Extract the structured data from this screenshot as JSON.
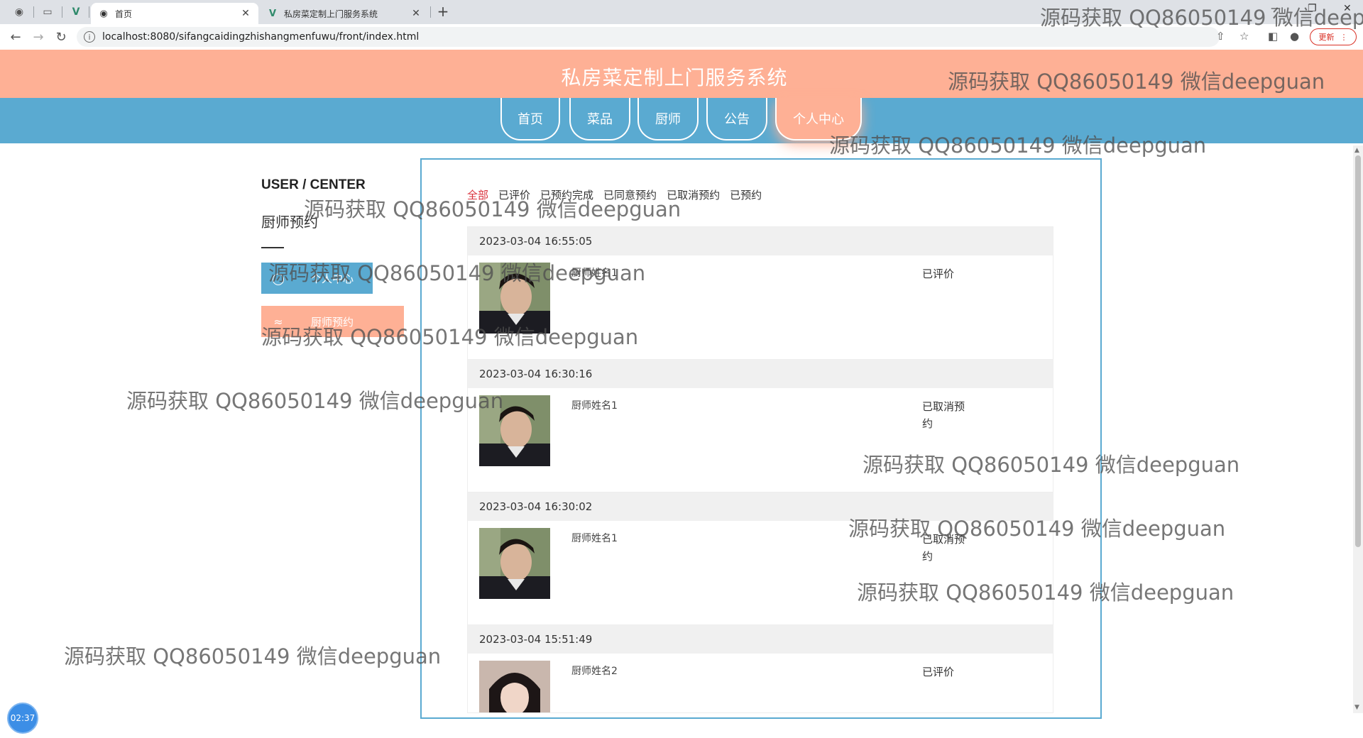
{
  "browser": {
    "tabs": [
      {
        "title": "首页",
        "active": true
      },
      {
        "title": "私房菜定制上门服务系统",
        "active": false
      }
    ],
    "url": "localhost:8080/sifangcaidingzhishangmenfuwu/front/index.html",
    "update_label": "更新"
  },
  "site": {
    "title": "私房菜定制上门服务系统",
    "nav": [
      "首页",
      "菜品",
      "厨师",
      "公告",
      "个人中心"
    ]
  },
  "sidebar": {
    "heading": "USER / CENTER",
    "subheading": "厨师预约",
    "items": [
      "个人中心",
      "厨师预约"
    ]
  },
  "filters": [
    "全部",
    "已评价",
    "已预约完成",
    "已同意预约",
    "已取消预约",
    "已预约"
  ],
  "orders": [
    {
      "time": "2023-03-04 16:55:05",
      "chef": "厨师姓名1",
      "status": "已评价"
    },
    {
      "time": "2023-03-04 16:30:16",
      "chef": "厨师姓名1",
      "status": "已取消预约"
    },
    {
      "time": "2023-03-04 16:30:02",
      "chef": "厨师姓名1",
      "status": "已取消预约"
    },
    {
      "time": "2023-03-04 15:51:49",
      "chef": "厨师姓名2",
      "status": "已评价"
    }
  ],
  "timer": "02:37",
  "watermark": "源码获取 QQ86050149 微信deepguan",
  "colors": {
    "header": "#feb095",
    "nav": "#5aaad1",
    "active_filter": "#d9313b"
  }
}
